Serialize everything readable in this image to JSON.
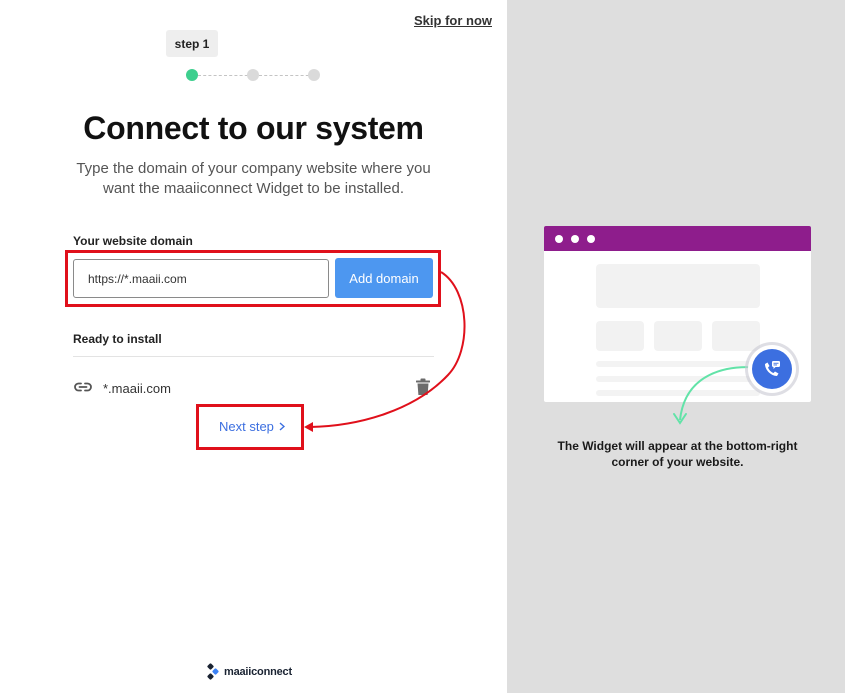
{
  "header": {
    "skip_label": "Skip for now",
    "step_label": "step 1"
  },
  "stepper": {
    "total_steps": 3,
    "current_step": 1,
    "active_color": "#3ecf8e",
    "inactive_color": "#dadada"
  },
  "main": {
    "title": "Connect to our system",
    "subtitle": "Type the domain of your company website where you want the maaiiconnect Widget to be installed.",
    "domain_field": {
      "label": "Your website domain",
      "value": "https://*.maaii.com",
      "button_label": "Add domain"
    },
    "ready": {
      "label": "Ready to install",
      "domains": [
        {
          "name": "*.maaii.com",
          "icon": "link-icon",
          "action_icon": "trash-icon"
        }
      ]
    },
    "next_label": "Next step"
  },
  "footer": {
    "logo_text": "maaiiconnect"
  },
  "preview": {
    "caption": "The Widget will appear at the bottom-right corner of your website.",
    "browser_bar_color": "#8e1d8c",
    "widget_color": "#3c6fe0",
    "widget_icon": "phone-chat-icon"
  },
  "colors": {
    "primary_button": "#4d97f0",
    "link": "#3c6fe0",
    "highlight": "#e0101b",
    "arrow_green": "#62e3a8"
  }
}
